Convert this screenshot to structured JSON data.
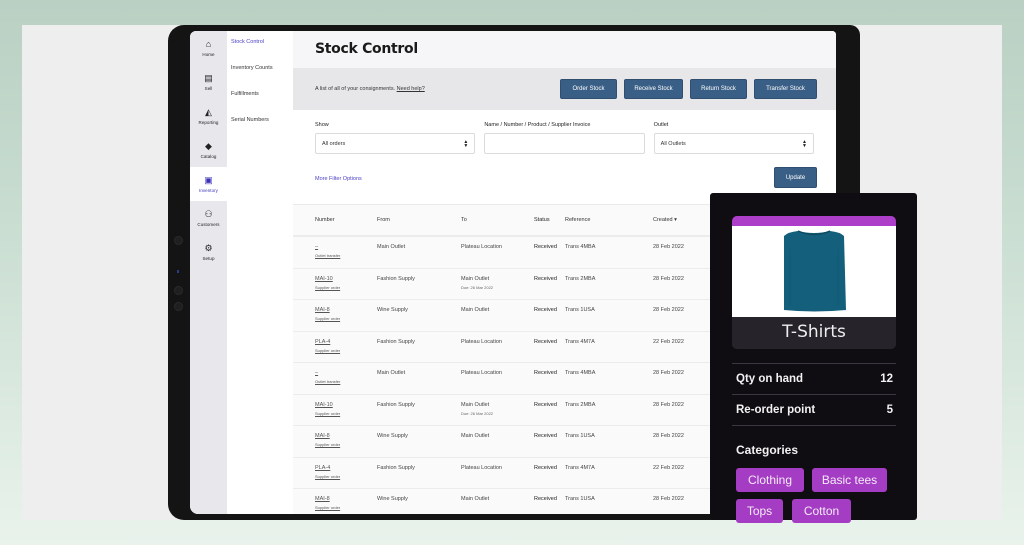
{
  "colors": {
    "primary_button": "#3a5f86",
    "active_nav": "#4a3fc4",
    "card_bg": "#0f0c12",
    "tag_bg": "#a43dc3",
    "product_accent": "#ad3ec9",
    "tshirt": "#14607c"
  },
  "iconbar": {
    "items": [
      {
        "label": "Home",
        "icon": "home-icon",
        "glyph": "⌂"
      },
      {
        "label": "Sell",
        "icon": "register-icon",
        "glyph": "▤"
      },
      {
        "label": "Reporting",
        "icon": "chart-icon",
        "glyph": "◭"
      },
      {
        "label": "Catalog",
        "icon": "tag-icon",
        "glyph": "◆"
      },
      {
        "label": "Inventory",
        "icon": "boxes-icon",
        "glyph": "▣"
      },
      {
        "label": "Customers",
        "icon": "users-icon",
        "glyph": "⚇"
      },
      {
        "label": "Setup",
        "icon": "gear-icon",
        "glyph": "⚙"
      }
    ]
  },
  "subnav": {
    "items": [
      "Stock Control",
      "Inventory Counts",
      "Fulfillments",
      "Serial Numbers"
    ]
  },
  "page": {
    "title": "Stock Control",
    "description": "A list of all of your consignments.",
    "help_link": "Need help?",
    "buttons": [
      "Order Stock",
      "Receive Stock",
      "Return Stock",
      "Transfer Stock"
    ]
  },
  "filters": {
    "show_label": "Show",
    "show_value": "All orders",
    "search_label": "Name / Number / Product / Supplier Invoice",
    "search_value": "",
    "outlet_label": "Outlet",
    "outlet_value": "All Outlets",
    "more_filters": "More Filter Options",
    "update": "Update"
  },
  "table": {
    "columns": [
      "Number",
      "From",
      "To",
      "Status",
      "Reference",
      "Created ▾"
    ],
    "rows": [
      {
        "number": "–",
        "type": "Outlet transfer",
        "from": "Main Outlet",
        "to": "Plateau Location",
        "due": "",
        "status": "Received",
        "reference": "Trans 4MBA",
        "created": "28 Feb 2022"
      },
      {
        "number": "MAI-10",
        "type": "Supplier order",
        "from": "Fashion Supply",
        "to": "Main Outlet",
        "due": "Due: 26 Mar 2022",
        "status": "Received",
        "reference": "Trans 2MBA",
        "created": "28 Feb 2022"
      },
      {
        "number": "MAI-8",
        "type": "Supplier order",
        "from": "Wine Supply",
        "to": "Main Outlet",
        "due": "",
        "status": "Received",
        "reference": "Trans 1USA",
        "created": "28 Feb 2022"
      },
      {
        "number": "PLA-4",
        "type": "Supplier order",
        "from": "Fashion Supply",
        "to": "Plateau Location",
        "due": "",
        "status": "Received",
        "reference": "Trans 4M7A",
        "created": "22 Feb 2022"
      },
      {
        "number": "–",
        "type": "Outlet transfer",
        "from": "Main Outlet",
        "to": "Plateau Location",
        "due": "",
        "status": "Received",
        "reference": "Trans 4MBA",
        "created": "28 Feb 2022"
      },
      {
        "number": "MAI-10",
        "type": "Supplier order",
        "from": "Fashion Supply",
        "to": "Main Outlet",
        "due": "Due: 26 Mar 2022",
        "status": "Received",
        "reference": "Trans 2MBA",
        "created": "28 Feb 2022"
      },
      {
        "number": "MAI-8",
        "type": "Supplier order",
        "from": "Wine Supply",
        "to": "Main Outlet",
        "due": "",
        "status": "Received",
        "reference": "Trans 1USA",
        "created": "28 Feb 2022"
      },
      {
        "number": "PLA-4",
        "type": "Supplier order",
        "from": "Fashion Supply",
        "to": "Plateau Location",
        "due": "",
        "status": "Received",
        "reference": "Trans 4M7A",
        "created": "22 Feb 2022"
      },
      {
        "number": "MAI-8",
        "type": "Supplier order",
        "from": "Wine Supply",
        "to": "Main Outlet",
        "due": "",
        "status": "Received",
        "reference": "Trans 1USA",
        "created": "28 Feb 2022"
      }
    ]
  },
  "product_card": {
    "name": "T-Shirts",
    "qty_label": "Qty on hand",
    "qty_value": "12",
    "reorder_label": "Re-order point",
    "reorder_value": "5",
    "categories_label": "Categories",
    "categories": [
      "Clothing",
      "Basic tees",
      "Tops",
      "Cotton"
    ]
  }
}
